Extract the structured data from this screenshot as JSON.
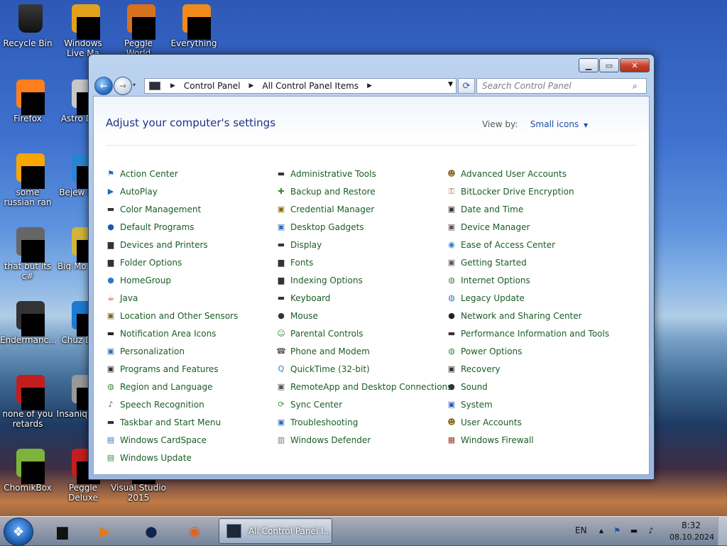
{
  "desktop": {
    "icons": [
      {
        "label": "Recycle Bin"
      },
      {
        "label": "Windows Live Ma"
      },
      {
        "label": "Peggle World"
      },
      {
        "label": "Everything"
      },
      {
        "label": "Firefox"
      },
      {
        "label": "Astro Delu"
      },
      {
        "label": "some russian ran a rat"
      },
      {
        "label": "Bejew Delu"
      },
      {
        "label": "that but its c#"
      },
      {
        "label": "Big Mo Delu"
      },
      {
        "label": "Endermanc..."
      },
      {
        "label": "Chuz Delu"
      },
      {
        "label": "none of you retards kno..."
      },
      {
        "label": "Insaniq Delu"
      },
      {
        "label": "ChomikBox"
      },
      {
        "label": "Peggle Deluxe"
      },
      {
        "label": "Visual Studio 2015"
      }
    ]
  },
  "window": {
    "caption": {
      "min": "▁",
      "max": "▭",
      "close": "✕"
    },
    "nav": {
      "back": "←",
      "forward": "→",
      "recent": "▾",
      "refresh": "⟳"
    },
    "address": {
      "crumbs": [
        "Control Panel",
        "All Control Panel Items"
      ],
      "separator": "▶",
      "dropdown": "▼"
    },
    "search": {
      "placeholder": "Search Control Panel",
      "icon": "⌕"
    },
    "header": {
      "title": "Adjust your computer's settings",
      "view_by_label": "View by:",
      "view_by_value": "Small icons",
      "caret": "▼"
    },
    "columns": [
      [
        {
          "label": "Action Center",
          "icon": "flag-icon",
          "color": "#2a5fb5",
          "glyph": "⚑"
        },
        {
          "label": "AutoPlay",
          "icon": "autoplay-icon",
          "color": "#1a6fb8",
          "glyph": "▶"
        },
        {
          "label": "Color Management",
          "icon": "monitor-icon",
          "color": "#333",
          "glyph": "▬"
        },
        {
          "label": "Default Programs",
          "icon": "default-programs-icon",
          "color": "#1c56b0",
          "glyph": "●"
        },
        {
          "label": "Devices and Printers",
          "icon": "printer-icon",
          "color": "#333",
          "glyph": "▆"
        },
        {
          "label": "Folder Options",
          "icon": "folder-icon",
          "color": "#333",
          "glyph": "▆"
        },
        {
          "label": "HomeGroup",
          "icon": "homegroup-icon",
          "color": "#2f79c4",
          "glyph": "●"
        },
        {
          "label": "Java",
          "icon": "java-icon",
          "color": "#c9462a",
          "glyph": "☕"
        },
        {
          "label": "Location and Other Sensors",
          "icon": "sensor-icon",
          "color": "#7a6a1a",
          "glyph": "▣"
        },
        {
          "label": "Notification Area Icons",
          "icon": "notification-icon",
          "color": "#222",
          "glyph": "▬"
        },
        {
          "label": "Personalization",
          "icon": "personalization-icon",
          "color": "#3a6ab5",
          "glyph": "▣"
        },
        {
          "label": "Programs and Features",
          "icon": "programs-icon",
          "color": "#333",
          "glyph": "▣"
        },
        {
          "label": "Region and Language",
          "icon": "globe-icon",
          "color": "#3a8a3a",
          "glyph": "◍"
        },
        {
          "label": "Speech Recognition",
          "icon": "microphone-icon",
          "color": "#555",
          "glyph": "♪"
        },
        {
          "label": "Taskbar and Start Menu",
          "icon": "taskbar-icon",
          "color": "#333",
          "glyph": "▬"
        },
        {
          "label": "Windows CardSpace",
          "icon": "cardspace-icon",
          "color": "#3b6fb8",
          "glyph": "▤"
        },
        {
          "label": "Windows Update",
          "icon": "update-icon",
          "color": "#3b8a3b",
          "glyph": "▤"
        }
      ],
      [
        {
          "label": "Administrative Tools",
          "icon": "admin-tools-icon",
          "color": "#333",
          "glyph": "▬"
        },
        {
          "label": "Backup and Restore",
          "icon": "backup-icon",
          "color": "#3a8a3a",
          "glyph": "✚"
        },
        {
          "label": "Credential Manager",
          "icon": "credential-icon",
          "color": "#8a6a1a",
          "glyph": "▣"
        },
        {
          "label": "Desktop Gadgets",
          "icon": "gadgets-icon",
          "color": "#2f6fb8",
          "glyph": "▣"
        },
        {
          "label": "Display",
          "icon": "display-icon",
          "color": "#333",
          "glyph": "▬"
        },
        {
          "label": "Fonts",
          "icon": "fonts-icon",
          "color": "#333",
          "glyph": "▆"
        },
        {
          "label": "Indexing Options",
          "icon": "indexing-icon",
          "color": "#333",
          "glyph": "▆"
        },
        {
          "label": "Keyboard",
          "icon": "keyboard-icon",
          "color": "#333",
          "glyph": "▬"
        },
        {
          "label": "Mouse",
          "icon": "mouse-icon",
          "color": "#333",
          "glyph": "●"
        },
        {
          "label": "Parental Controls",
          "icon": "parental-icon",
          "color": "#3a8a3a",
          "glyph": "☺"
        },
        {
          "label": "Phone and Modem",
          "icon": "phone-icon",
          "color": "#555",
          "glyph": "☎"
        },
        {
          "label": "QuickTime (32-bit)",
          "icon": "quicktime-icon",
          "color": "#2f79c4",
          "glyph": "Q"
        },
        {
          "label": "RemoteApp and Desktop Connections",
          "icon": "remoteapp-icon",
          "color": "#555",
          "glyph": "▣"
        },
        {
          "label": "Sync Center",
          "icon": "sync-icon",
          "color": "#3a9a3a",
          "glyph": "⟳"
        },
        {
          "label": "Troubleshooting",
          "icon": "troubleshoot-icon",
          "color": "#2f6fb8",
          "glyph": "▣"
        },
        {
          "label": "Windows Defender",
          "icon": "defender-icon",
          "color": "#777",
          "glyph": "▥"
        }
      ],
      [
        {
          "label": "Advanced User Accounts",
          "icon": "users-icon",
          "color": "#8a6a1a",
          "glyph": "☻"
        },
        {
          "label": "BitLocker Drive Encryption",
          "icon": "bitlocker-icon",
          "color": "#8a6a1a",
          "glyph": "⚿"
        },
        {
          "label": "Date and Time",
          "icon": "clock-icon",
          "color": "#333",
          "glyph": "▣"
        },
        {
          "label": "Device Manager",
          "icon": "device-manager-icon",
          "color": "#555",
          "glyph": "▣"
        },
        {
          "label": "Ease of Access Center",
          "icon": "ease-of-access-icon",
          "color": "#2f79c4",
          "glyph": "◉"
        },
        {
          "label": "Getting Started",
          "icon": "getting-started-icon",
          "color": "#555",
          "glyph": "▣"
        },
        {
          "label": "Internet Options",
          "icon": "internet-icon",
          "color": "#3a8a3a",
          "glyph": "◍"
        },
        {
          "label": "Legacy Update",
          "icon": "legacy-update-icon",
          "color": "#2f79c4",
          "glyph": "◍"
        },
        {
          "label": "Network and Sharing Center",
          "icon": "network-icon",
          "color": "#222",
          "glyph": "●"
        },
        {
          "label": "Performance Information and Tools",
          "icon": "performance-icon",
          "color": "#333",
          "glyph": "▬"
        },
        {
          "label": "Power Options",
          "icon": "power-icon",
          "color": "#3a8a3a",
          "glyph": "◍"
        },
        {
          "label": "Recovery",
          "icon": "recovery-icon",
          "color": "#333",
          "glyph": "▣"
        },
        {
          "label": "Sound",
          "icon": "sound-icon",
          "color": "#333",
          "glyph": "●"
        },
        {
          "label": "System",
          "icon": "system-icon",
          "color": "#2f5fb0",
          "glyph": "▣"
        },
        {
          "label": "User Accounts",
          "icon": "user-accounts-icon",
          "color": "#8a6a1a",
          "glyph": "☻"
        },
        {
          "label": "Windows Firewall",
          "icon": "firewall-icon",
          "color": "#a03a2a",
          "glyph": "▦"
        }
      ]
    ]
  },
  "taskbar": {
    "start_glyph": "❖",
    "pinned": [
      {
        "name": "explorer-icon",
        "glyph": "▆",
        "color": "#111"
      },
      {
        "name": "media-player-icon",
        "glyph": "▶",
        "color": "#e07a1a"
      },
      {
        "name": "app-globe-icon",
        "glyph": "●",
        "color": "#0f2550"
      },
      {
        "name": "firefox-icon",
        "glyph": "◉",
        "color": "#e5601a"
      }
    ],
    "active_task": "All Control Panel I...",
    "tray": {
      "language": "EN",
      "up_arrow": "▲",
      "time": "8:32",
      "date": "08.10.2024"
    }
  }
}
